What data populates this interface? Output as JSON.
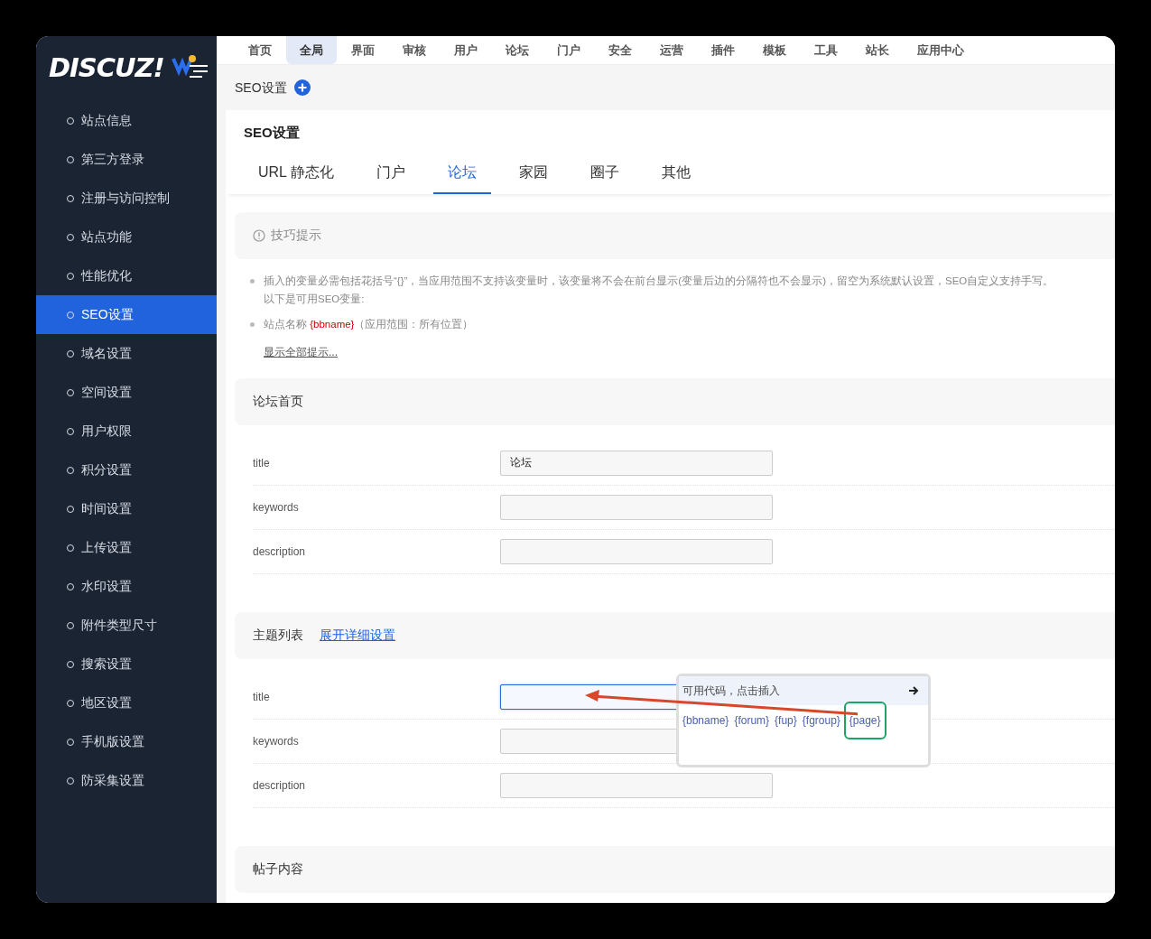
{
  "logo": {
    "text": "DISCUZ!"
  },
  "top_nav": [
    {
      "label": "首页",
      "selected": false
    },
    {
      "label": "全局",
      "selected": true
    },
    {
      "label": "界面",
      "selected": false
    },
    {
      "label": "审核",
      "selected": false
    },
    {
      "label": "用户",
      "selected": false
    },
    {
      "label": "论坛",
      "selected": false
    },
    {
      "label": "门户",
      "selected": false
    },
    {
      "label": "安全",
      "selected": false
    },
    {
      "label": "运营",
      "selected": false
    },
    {
      "label": "插件",
      "selected": false
    },
    {
      "label": "模板",
      "selected": false
    },
    {
      "label": "工具",
      "selected": false
    },
    {
      "label": "站长",
      "selected": false
    },
    {
      "label": "应用中心",
      "selected": false
    }
  ],
  "sidebar": {
    "items": [
      {
        "label": "站点信息",
        "selected": false
      },
      {
        "label": "第三方登录",
        "selected": false
      },
      {
        "label": "注册与访问控制",
        "selected": false
      },
      {
        "label": "站点功能",
        "selected": false
      },
      {
        "label": "性能优化",
        "selected": false
      },
      {
        "label": "SEO设置",
        "selected": true
      },
      {
        "label": "域名设置",
        "selected": false
      },
      {
        "label": "空间设置",
        "selected": false
      },
      {
        "label": "用户权限",
        "selected": false
      },
      {
        "label": "积分设置",
        "selected": false
      },
      {
        "label": "时间设置",
        "selected": false
      },
      {
        "label": "上传设置",
        "selected": false
      },
      {
        "label": "水印设置",
        "selected": false
      },
      {
        "label": "附件类型尺寸",
        "selected": false
      },
      {
        "label": "搜索设置",
        "selected": false
      },
      {
        "label": "地区设置",
        "selected": false
      },
      {
        "label": "手机版设置",
        "selected": false
      },
      {
        "label": "防采集设置",
        "selected": false
      }
    ]
  },
  "breadcrumb": {
    "title": "SEO设置"
  },
  "page_title": "SEO设置",
  "tabs": [
    {
      "label": "URL 静态化",
      "selected": false
    },
    {
      "label": "门户",
      "selected": false
    },
    {
      "label": "论坛",
      "selected": true
    },
    {
      "label": "家园",
      "selected": false
    },
    {
      "label": "圈子",
      "selected": false
    },
    {
      "label": "其他",
      "selected": false
    }
  ],
  "tips": {
    "title": "技巧提示",
    "items": [
      {
        "lines": [
          "插入的变量必需包括花括号“{}”，当应用范围不支持该变量时，该变量将不会在前台显示(变量后边的分隔符也不会显示)，留空为系统默认设置，SEO自定义支持手写。",
          "以下是可用SEO变量:"
        ]
      },
      {
        "lines": [
          "站点名称 **{bbname}**（应用范围：所有位置）"
        ]
      }
    ],
    "show_all_link": "显示全部提示..."
  },
  "sections": [
    {
      "title": "论坛首页",
      "fields": [
        {
          "label": "title",
          "value": "论坛",
          "focused": false
        },
        {
          "label": "keywords",
          "focused": false
        },
        {
          "label": "description",
          "focused": false
        }
      ]
    },
    {
      "title": "主题列表",
      "link": "展开详细设置",
      "fields": [
        {
          "label": "title",
          "focused": true
        },
        {
          "label": "keywords",
          "focused": false
        },
        {
          "label": "description",
          "focused": false
        }
      ]
    },
    {
      "title": "帖子内容"
    }
  ],
  "code_popup": {
    "title": "可用代码，点击插入",
    "codes": [
      {
        "code": "{bbname}",
        "highlighted": false
      },
      {
        "code": "{forum}",
        "highlighted": false
      },
      {
        "code": "{fup}",
        "highlighted": false
      },
      {
        "code": "{fgroup}",
        "highlighted": false
      },
      {
        "code": "{page}",
        "highlighted": true
      }
    ]
  }
}
